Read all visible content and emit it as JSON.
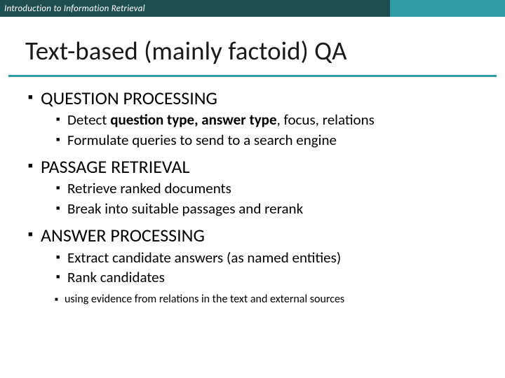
{
  "header": {
    "course": "Introduction to Information Retrieval"
  },
  "title": "Text-based (mainly factoid) QA",
  "sections": [
    {
      "heading": "QUESTION PROCESSING",
      "items": [
        {
          "prefix": "Detect ",
          "bold": "question type, answer type",
          "suffix": ", focus, relations"
        },
        {
          "text": "Formulate queries to send to a search engine"
        }
      ]
    },
    {
      "heading": "PASSAGE RETRIEVAL",
      "items": [
        {
          "text": "Retrieve ranked documents"
        },
        {
          "text": "Break into suitable passages and rerank"
        }
      ]
    },
    {
      "heading": "ANSWER PROCESSING",
      "items": [
        {
          "text": "Extract candidate answers (as named entities)"
        },
        {
          "text": "Rank candidates",
          "sub": [
            {
              "text": "using evidence from relations in the text and external sources"
            }
          ]
        }
      ]
    }
  ]
}
